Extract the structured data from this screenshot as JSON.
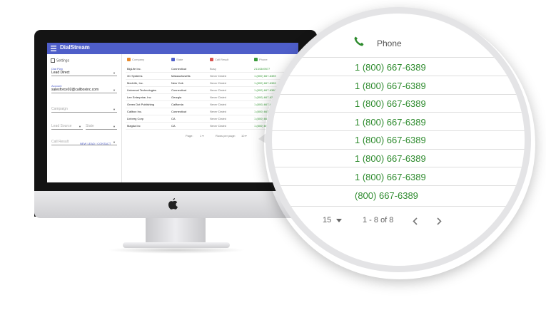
{
  "app": {
    "title": "DialStream"
  },
  "sidebar": {
    "settings_label": "Settings",
    "dial_plan_label": "Dial Plan",
    "dial_plan_value": "Lead Direct",
    "account_label": "Account",
    "account_value": "salesforce02@callboxinc.com",
    "campaign_placeholder": "Campaign",
    "lead_source_placeholder": "Lead Source",
    "state_placeholder": "State",
    "call_result_placeholder": "Call Result",
    "new_lead_link": "NEW LEAD / CONTACT"
  },
  "table": {
    "headers": [
      "Company",
      "State",
      "Call Result",
      "Phone"
    ],
    "rows": [
      [
        "BigLife Inc.",
        "Connecticut",
        "Busy",
        "2134349577"
      ],
      [
        "3C Systems",
        "Massachusetts",
        "Never Dialed",
        "1 (800) 667-6389"
      ],
      [
        "MedLife, Inc.",
        "New York",
        "Never Dialed",
        "1 (800) 667-6389"
      ],
      [
        "Universal Technologies",
        "Connecticut",
        "Never Dialed",
        "1 (800) 667-6389"
      ],
      [
        "Lee Enterprise, Inc",
        "Georgia",
        "Never Dialed",
        "1 (800) 667-6389"
      ],
      [
        "Green Dot Publishing",
        "California",
        "Never Dialed",
        "1 (800) 667-6389"
      ],
      [
        "Callbox Inc.",
        "Connecticut",
        "Never Dialed",
        "1 (800) 667-6389"
      ],
      [
        "Linberg Corp",
        "CA",
        "Never Dialed",
        "1 (800) 667-6389"
      ],
      [
        "Magda Inc",
        "CA",
        "Never Dialed",
        "1 (800) 667-6389"
      ]
    ],
    "pager_page": "Page:",
    "pager_page_value": "1",
    "pager_rows_label": "Rows per page:",
    "pager_rows_value": "10"
  },
  "zoom": {
    "header": "Phone",
    "phones": [
      "1 (800) 667-6389",
      "1 (800) 667-6389",
      "1 (800) 667-6389",
      "1 (800) 667-6389",
      "1 (800) 667-6389",
      "1 (800) 667-6389",
      "1 (800) 667-6389",
      "(800) 667-6389"
    ],
    "rows_per_page": "15",
    "range": "1 - 8 of 8"
  },
  "colors": {
    "appbar": "#4e5ec9",
    "phone_green": "#2e8b2e"
  }
}
